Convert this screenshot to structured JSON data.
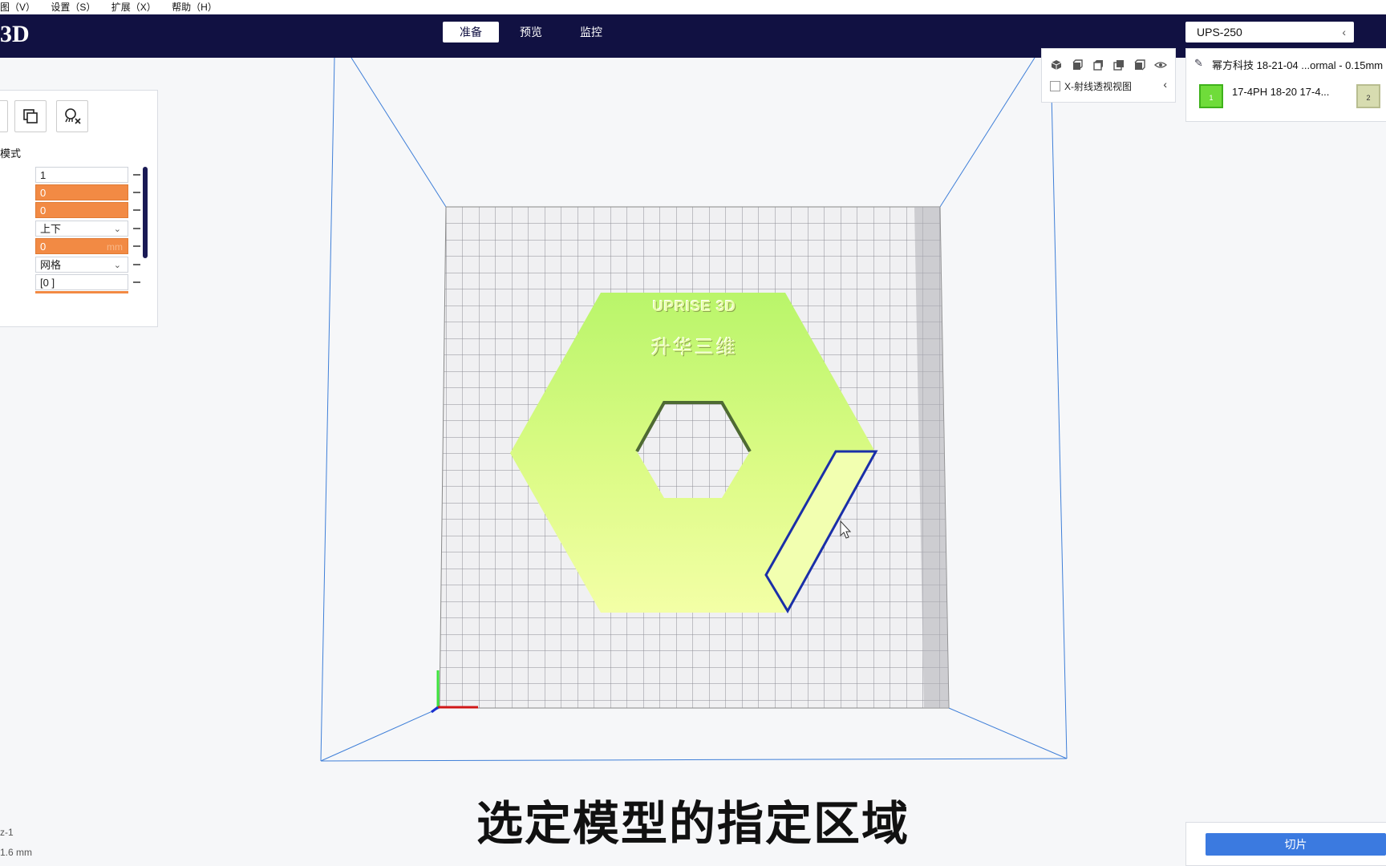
{
  "menu": {
    "items": [
      "图（V）",
      "设置（S）",
      "扩展（X）",
      "帮助（H）"
    ]
  },
  "header": {
    "logo": "3D",
    "tabs": [
      {
        "label": "准备",
        "active": true
      },
      {
        "label": "预览",
        "active": false
      },
      {
        "label": "监控",
        "active": false
      }
    ],
    "printer": "UPS-250",
    "printer_icon": "chevron-left-icon"
  },
  "left_panel": {
    "tool_icons": [
      "cube-partial-icon",
      "copy-layers-icon",
      "support-remove-icon"
    ],
    "mode_label": "模式",
    "fields": [
      {
        "value": "1",
        "style": "plain"
      },
      {
        "value": "0",
        "style": "orange"
      },
      {
        "value": "0",
        "style": "orange"
      },
      {
        "value": "上下",
        "style": "select"
      },
      {
        "value": "0",
        "style": "orange",
        "unit": "mm"
      },
      {
        "value": "网格",
        "style": "select"
      },
      {
        "value": "[0 ]",
        "style": "plain"
      }
    ]
  },
  "view_panel": {
    "icons": [
      "iso-view-icon",
      "front-view-icon",
      "top-view-icon",
      "left-view-icon",
      "right-view-icon",
      "eye-icon"
    ],
    "xray_label": "X-射线透视视图",
    "xray_checked": false
  },
  "object_panel": {
    "profile": "幂方科技 18-21-04 ...ormal - 0.15mm",
    "models": [
      {
        "index": "1",
        "name": "17-4PH 18-20 17-4..."
      },
      {
        "index": "2",
        "name": ""
      }
    ]
  },
  "viewport": {
    "model_text_en": "UPRISE 3D",
    "model_text_cn": "升华三维",
    "model_color": "#c8f77a",
    "selection_color": "#1a2fa8"
  },
  "caption": "选定模型的指定区域",
  "status": {
    "line1": "z-1",
    "line2": "1.6 mm"
  },
  "slice_button": "切片"
}
